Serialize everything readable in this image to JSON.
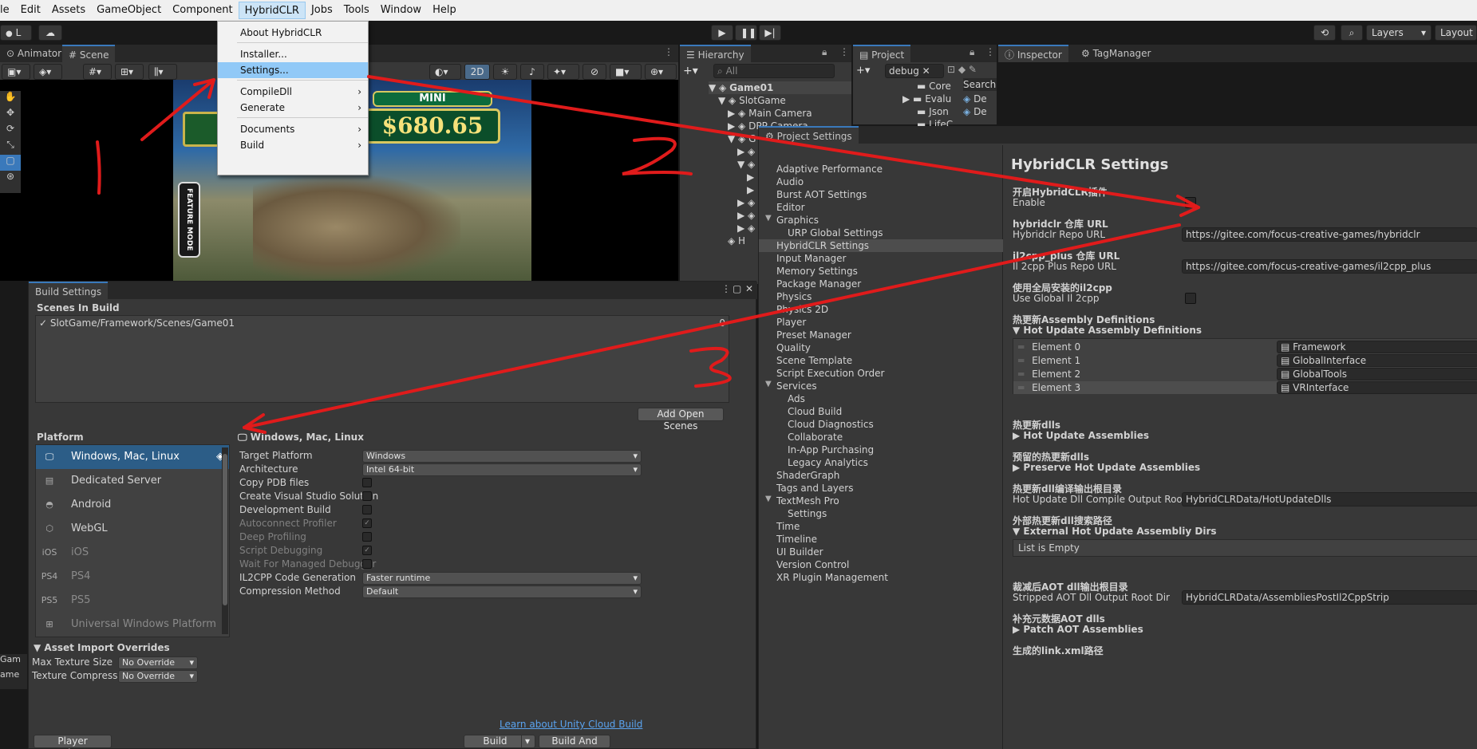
{
  "menubar": {
    "items": [
      "le",
      "Edit",
      "Assets",
      "GameObject",
      "Component",
      "HybridCLR",
      "Jobs",
      "Tools",
      "Window",
      "Help"
    ]
  },
  "toolbar": {
    "account_initial": "L",
    "layers_label": "Layers",
    "layout_label": "Layout"
  },
  "hybridclr_menu": {
    "items": [
      "About HybridCLR",
      "Installer...",
      "Settings...",
      "CompileDll",
      "Generate",
      "Documents",
      "Build"
    ]
  },
  "scene_view": {
    "tabs": [
      "Animator",
      "Scene"
    ],
    "mode_2d": "2D",
    "game_banner_label": "MINI",
    "game_amount": "$680.65",
    "feature_mode": "FEATURE MODE"
  },
  "hierarchy": {
    "tab_label": "Hierarchy",
    "search_placeholder": "All",
    "rows": [
      "Game01",
      "SlotGame",
      "Main Camera",
      "DPP Camera",
      "G",
      "H"
    ]
  },
  "project": {
    "tab_label": "Project",
    "search_value": "debug",
    "folders": [
      "Core",
      "Evalu",
      "Json",
      "LifeC"
    ],
    "search_label": "Search",
    "result_prefix": "De"
  },
  "inspector": {
    "tab_label": "Inspector",
    "tag_manager": "TagManager"
  },
  "project_settings": {
    "title": "Project Settings",
    "categories": [
      "Adaptive Performance",
      "Audio",
      "Burst AOT Settings",
      "Editor",
      "Graphics",
      "URP Global Settings",
      "HybridCLR Settings",
      "Input Manager",
      "Memory Settings",
      "Package Manager",
      "Physics",
      "Physics 2D",
      "Player",
      "Preset Manager",
      "Quality",
      "Scene Template",
      "Script Execution Order",
      "Services",
      "Ads",
      "Cloud Build",
      "Cloud Diagnostics",
      "Collaborate",
      "In-App Purchasing",
      "Legacy Analytics",
      "ShaderGraph",
      "Tags and Layers",
      "TextMesh Pro",
      "Settings",
      "Time",
      "Timeline",
      "UI Builder",
      "Version Control",
      "XR Plugin Management"
    ]
  },
  "hybridclr_settings": {
    "header": "HybridCLR Settings",
    "enable_cn": "开启HybridCLR插件",
    "enable_en": "Enable",
    "repo_cn": "hybridclr 仓库 URL",
    "repo_en": "Hybridclr Repo URL",
    "repo_value": "https://gitee.com/focus-creative-games/hybridclr",
    "il2cpp_cn": "il2cpp_plus 仓库 URL",
    "il2cpp_en": "Il 2cpp Plus Repo URL",
    "il2cpp_value": "https://gitee.com/focus-creative-games/il2cpp_plus",
    "global_cn": "使用全局安装的il2cpp",
    "global_en": "Use Global Il 2cpp",
    "hot_asm_def_cn": "热更新Assembly Definitions",
    "hot_asm_def_en": "Hot Update Assembly Definitions",
    "elements": [
      {
        "label": "Element 0",
        "value": "Framework"
      },
      {
        "label": "Element 1",
        "value": "GlobalInterface"
      },
      {
        "label": "Element 2",
        "value": "GlobalTools"
      },
      {
        "label": "Element 3",
        "value": "VRInterface"
      }
    ],
    "hot_dlls_cn": "热更新dlls",
    "hot_dlls_en": "Hot Update Assemblies",
    "preserve_cn": "预留的热更新dlls",
    "preserve_en": "Preserve Hot Update Assemblies",
    "compile_dir_cn": "热更新dll编译输出根目录",
    "compile_dir_en": "Hot Update Dll Compile Output Root Dir",
    "compile_dir_value": "HybridCLRData/HotUpdateDlls",
    "ext_dirs_cn": "外部热更新dll搜索路径",
    "ext_dirs_en": "External Hot Update Assembliy Dirs",
    "list_empty": "List is Empty",
    "stripped_cn": "裁减后AOT dll输出根目录",
    "stripped_en": "Stripped AOT Dll Output Root Dir",
    "stripped_value": "HybridCLRData/AssembliesPostIl2CppStrip",
    "patch_cn": "补充元数据AOT dlls",
    "patch_en": "Patch AOT Assemblies",
    "link_cn": "生成的link.xml路径"
  },
  "build_settings": {
    "title": "Build Settings",
    "scenes_header": "Scenes In Build",
    "scene_path": "SlotGame/Framework/Scenes/Game01",
    "scene_index": "0",
    "add_open_scenes": "Add Open Scenes",
    "platform_header": "Platform",
    "platforms": [
      "Windows, Mac, Linux",
      "Dedicated Server",
      "Android",
      "WebGL",
      "iOS",
      "PS4",
      "PS5",
      "Universal Windows Platform"
    ],
    "selected_platform_title": "Windows, Mac, Linux",
    "options": {
      "target_platform": "Target Platform",
      "target_platform_value": "Windows",
      "architecture": "Architecture",
      "architecture_value": "Intel 64-bit",
      "copy_pdb": "Copy PDB files",
      "create_vs": "Create Visual Studio Solution",
      "dev_build": "Development Build",
      "autoconnect": "Autoconnect Profiler",
      "deep_profiling": "Deep Profiling",
      "script_debugging": "Script Debugging",
      "wait_debugger": "Wait For Managed Debugger",
      "il2cpp_codegen": "IL2CPP Code Generation",
      "il2cpp_codegen_value": "Faster runtime",
      "compression": "Compression Method",
      "compression_value": "Default"
    },
    "asset_import_header": "Asset Import Overrides",
    "max_texture_size": "Max Texture Size",
    "max_texture_size_value": "No Override",
    "texture_compression": "Texture Compression",
    "texture_compression_value": "No Override",
    "learn_cloud": "Learn about Unity Cloud Build",
    "player_settings": "Player Settings...",
    "build": "Build",
    "build_and_run": "Build And Run"
  },
  "left_edge": {
    "game_tab": "Gam",
    "game_label": "ame"
  },
  "annotations": {
    "colors": {
      "arrow": "#e01b1b"
    }
  }
}
